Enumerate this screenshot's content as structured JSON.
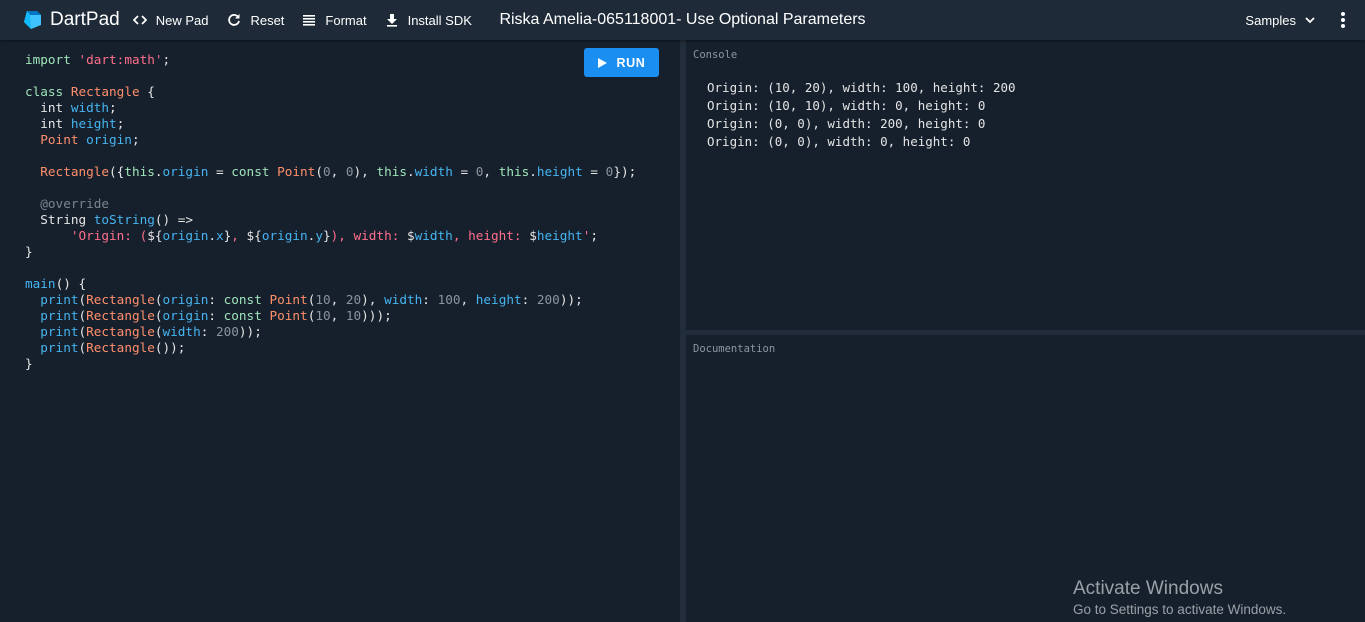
{
  "app": {
    "name": "DartPad",
    "title": "Riska Amelia-065118001- Use Optional Parameters"
  },
  "toolbar": {
    "new_pad": "New Pad",
    "reset": "Reset",
    "format": "Format",
    "install_sdk": "Install SDK",
    "samples": "Samples"
  },
  "editor": {
    "run_label": "RUN",
    "code_lines": [
      [
        [
          "kw",
          "import "
        ],
        [
          "str",
          "'dart:math'"
        ],
        [
          "p",
          ";"
        ]
      ],
      [],
      [
        [
          "kw",
          "class "
        ],
        [
          "cls",
          "Rectangle"
        ],
        [
          "p",
          " {"
        ]
      ],
      [
        [
          "p",
          "  int "
        ],
        [
          "fn",
          "width"
        ],
        [
          "p",
          ";"
        ]
      ],
      [
        [
          "p",
          "  int "
        ],
        [
          "fn",
          "height"
        ],
        [
          "p",
          ";"
        ]
      ],
      [
        [
          "cls",
          "  Point "
        ],
        [
          "fn",
          "origin"
        ],
        [
          "p",
          ";"
        ]
      ],
      [],
      [
        [
          "cls",
          "  Rectangle"
        ],
        [
          "p",
          "({"
        ],
        [
          "kw",
          "this"
        ],
        [
          "p",
          "."
        ],
        [
          "fn",
          "origin"
        ],
        [
          "p",
          " = "
        ],
        [
          "kw",
          "const "
        ],
        [
          "cls",
          "Point"
        ],
        [
          "p",
          "("
        ],
        [
          "num",
          "0"
        ],
        [
          "p",
          ", "
        ],
        [
          "num",
          "0"
        ],
        [
          "p",
          "), "
        ],
        [
          "kw",
          "this"
        ],
        [
          "p",
          "."
        ],
        [
          "fn",
          "width"
        ],
        [
          "p",
          " = "
        ],
        [
          "num",
          "0"
        ],
        [
          "p",
          ", "
        ],
        [
          "kw",
          "this"
        ],
        [
          "p",
          "."
        ],
        [
          "fn",
          "height"
        ],
        [
          "p",
          " = "
        ],
        [
          "num",
          "0"
        ],
        [
          "p",
          "});"
        ]
      ],
      [],
      [
        [
          "cmt",
          "  @override"
        ]
      ],
      [
        [
          "p",
          "  String "
        ],
        [
          "fn",
          "toString"
        ],
        [
          "p",
          "() =>"
        ]
      ],
      [
        [
          "str",
          "      'Origin: ("
        ],
        [
          "p",
          "${"
        ],
        [
          "fn",
          "origin"
        ],
        [
          "p",
          "."
        ],
        [
          "fn",
          "x"
        ],
        [
          "p",
          "}"
        ],
        [
          "str",
          ", "
        ],
        [
          "p",
          "${"
        ],
        [
          "fn",
          "origin"
        ],
        [
          "p",
          "."
        ],
        [
          "fn",
          "y"
        ],
        [
          "p",
          "}"
        ],
        [
          "str",
          "), width: "
        ],
        [
          "p",
          "$"
        ],
        [
          "fn",
          "width"
        ],
        [
          "str",
          ", height: "
        ],
        [
          "p",
          "$"
        ],
        [
          "fn",
          "height"
        ],
        [
          "str",
          "'"
        ],
        [
          "p",
          ";"
        ]
      ],
      [
        [
          "p",
          "}"
        ]
      ],
      [],
      [
        [
          "fn",
          "main"
        ],
        [
          "p",
          "() {"
        ]
      ],
      [
        [
          "fn",
          "  print"
        ],
        [
          "p",
          "("
        ],
        [
          "cls",
          "Rectangle"
        ],
        [
          "p",
          "("
        ],
        [
          "fn",
          "origin"
        ],
        [
          "p",
          ": "
        ],
        [
          "kw",
          "const "
        ],
        [
          "cls",
          "Point"
        ],
        [
          "p",
          "("
        ],
        [
          "num",
          "10"
        ],
        [
          "p",
          ", "
        ],
        [
          "num",
          "20"
        ],
        [
          "p",
          "), "
        ],
        [
          "fn",
          "width"
        ],
        [
          "p",
          ": "
        ],
        [
          "num",
          "100"
        ],
        [
          "p",
          ", "
        ],
        [
          "fn",
          "height"
        ],
        [
          "p",
          ": "
        ],
        [
          "num",
          "200"
        ],
        [
          "p",
          "));"
        ]
      ],
      [
        [
          "fn",
          "  print"
        ],
        [
          "p",
          "("
        ],
        [
          "cls",
          "Rectangle"
        ],
        [
          "p",
          "("
        ],
        [
          "fn",
          "origin"
        ],
        [
          "p",
          ": "
        ],
        [
          "kw",
          "const "
        ],
        [
          "cls",
          "Point"
        ],
        [
          "p",
          "("
        ],
        [
          "num",
          "10"
        ],
        [
          "p",
          ", "
        ],
        [
          "num",
          "10"
        ],
        [
          "p",
          ")));"
        ]
      ],
      [
        [
          "fn",
          "  print"
        ],
        [
          "p",
          "("
        ],
        [
          "cls",
          "Rectangle"
        ],
        [
          "p",
          "("
        ],
        [
          "fn",
          "width"
        ],
        [
          "p",
          ": "
        ],
        [
          "num",
          "200"
        ],
        [
          "p",
          "));"
        ]
      ],
      [
        [
          "fn",
          "  print"
        ],
        [
          "p",
          "("
        ],
        [
          "cls",
          "Rectangle"
        ],
        [
          "p",
          "());"
        ]
      ],
      [
        [
          "p",
          "}"
        ]
      ]
    ]
  },
  "console": {
    "label": "Console",
    "lines": [
      "Origin: (10, 20), width: 100, height: 200",
      "Origin: (10, 10), width: 0, height: 0",
      "Origin: (0, 0), width: 200, height: 0",
      "Origin: (0, 0), width: 0, height: 0"
    ]
  },
  "documentation": {
    "label": "Documentation"
  },
  "watermark": {
    "title": "Activate Windows",
    "subtitle": "Go to Settings to activate Windows."
  },
  "colors": {
    "accent": "#1b8ef2",
    "background": "#16202d",
    "toolbar": "#1f2a38"
  },
  "icons": {
    "logo": "dart-logo-icon",
    "new_pad": "code-brackets-icon",
    "reset": "refresh-icon",
    "format": "format-lines-icon",
    "install_sdk": "download-icon",
    "samples": "chevron-down-icon",
    "more": "more-vertical-icon",
    "run": "play-icon"
  }
}
